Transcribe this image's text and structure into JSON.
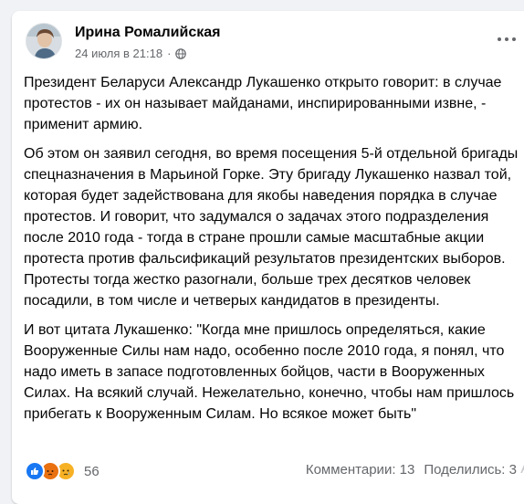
{
  "post": {
    "author": "Ирина Ромалийская",
    "date": "24 июля в 21:18",
    "separator": "·",
    "privacy_icon": "globe-icon",
    "more_icon": "more-options-icon",
    "paragraphs": [
      "Президент Беларуси Александр Лукашенко открыто говорит: в случае протестов - их он называет майданами, инспирированными извне, - применит армию.",
      "Об этом он заявил сегодня, во время посещения 5-й отдельной бригады спецназначения в Марьиной Горке. Эту бригаду Лукашенко назвал той, которая будет задействована для якобы наведения порядка в случае протестов. И говорит, что задумался о задачах этого подразделения после 2010 года - тогда в стране прошли самые масштабные акции протеста против фальсификаций результатов президентских выборов. Протесты тогда жестко разогнали, больше трех десятков человек посадили, в том числе и четверых кандидатов в президенты.",
      "И вот цитата Лукашенко: \"Когда мне пришлось определяться, какие Вооруженные Силы нам надо, особенно после 2010 года, я понял, что надо иметь в запасе подготовленных бойцов, части в Вооруженных Силах. На всякий случай. Нежелательно, конечно, чтобы нам пришлось прибегать к Вооруженным Силам. Но всякое может быть\""
    ]
  },
  "footer": {
    "reactions": [
      "like-icon",
      "angry-icon",
      "sad-icon"
    ],
    "reaction_count": "56",
    "comments": "Комментарии: 13",
    "shares": "Поделились: 3",
    "faded_text": "Ак"
  },
  "colors": {
    "background": "#f0f2f5",
    "card": "#ffffff",
    "text": "#050505",
    "secondary": "#65676b",
    "like": "#1877f2",
    "angry": "#e9710f",
    "sad": "#f7b125"
  }
}
